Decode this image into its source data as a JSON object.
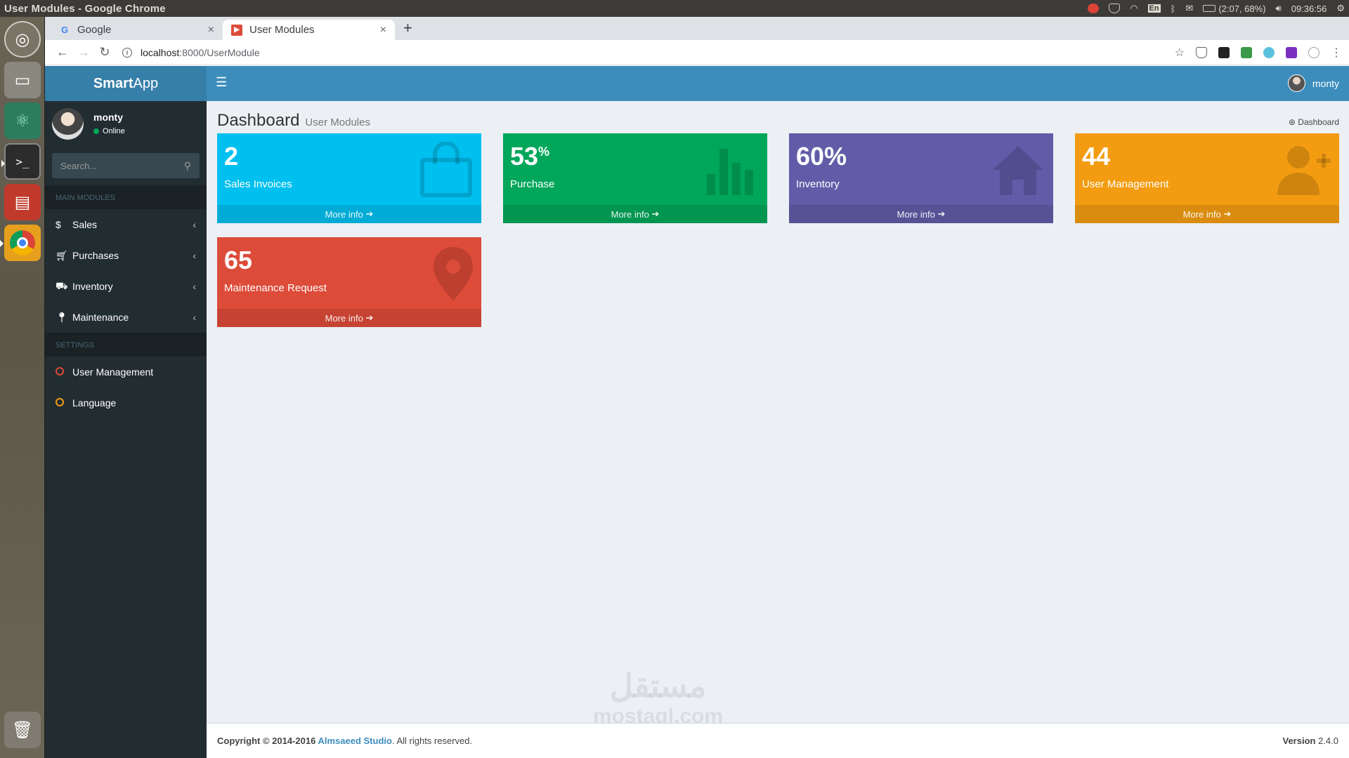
{
  "os": {
    "window_title": "User Modules - Google Chrome",
    "keyboard": "En",
    "battery": "(2:07, 68%)",
    "clock": "09:36:56"
  },
  "browser": {
    "tabs": [
      {
        "label": "Google",
        "active": false
      },
      {
        "label": "User Modules",
        "active": true
      }
    ],
    "url_host": "localhost",
    "url_path": ":8000/UserModule"
  },
  "app": {
    "logo_bold": "Smart",
    "logo_rest": "App",
    "header_user": "monty",
    "sidebar": {
      "user_name": "monty",
      "user_status": "Online",
      "search_placeholder": "Search...",
      "main_header": "MAIN MODULES",
      "main_items": [
        {
          "label": "Sales",
          "icon": "dollar-icon"
        },
        {
          "label": "Purchases",
          "icon": "cart-icon"
        },
        {
          "label": "Inventory",
          "icon": "truck-icon"
        },
        {
          "label": "Maintenance",
          "icon": "pin-icon"
        }
      ],
      "settings_header": "SETTINGS",
      "settings_items": [
        {
          "label": "User Management",
          "ring_color": "#dd4b39"
        },
        {
          "label": "Language",
          "ring_color": "#f39c12"
        }
      ]
    },
    "page": {
      "title": "Dashboard",
      "subtitle": "User Modules",
      "breadcrumb": "Dashboard"
    },
    "boxes": [
      {
        "value": "2",
        "sup": "",
        "label": "Sales Invoices",
        "more": "More info",
        "color": "#00c0ef",
        "icon": "shopping-bag-icon"
      },
      {
        "value": "53",
        "sup": "%",
        "label": "Purchase",
        "more": "More info",
        "color": "#00a65a",
        "icon": "bar-chart-icon"
      },
      {
        "value": "60%",
        "sup": "",
        "label": "Inventory",
        "more": "More info",
        "color": "#605ca8",
        "icon": "home-icon"
      },
      {
        "value": "44",
        "sup": "",
        "label": "User Management",
        "more": "More info",
        "color": "#f39c12",
        "icon": "user-plus-icon"
      },
      {
        "value": "65",
        "sup": "",
        "label": "Maintenance Request",
        "more": "More info",
        "color": "#dd4b39",
        "icon": "map-marker-icon"
      }
    ],
    "footer": {
      "copyright": "Copyright © 2014-2016 ",
      "studio": "Almsaeed Studio",
      "rights": ". All rights reserved.",
      "version_label": "Version",
      "version": "2.4.0"
    },
    "watermark": {
      "line1": "مستقل",
      "line2": "mostaql.com"
    }
  }
}
